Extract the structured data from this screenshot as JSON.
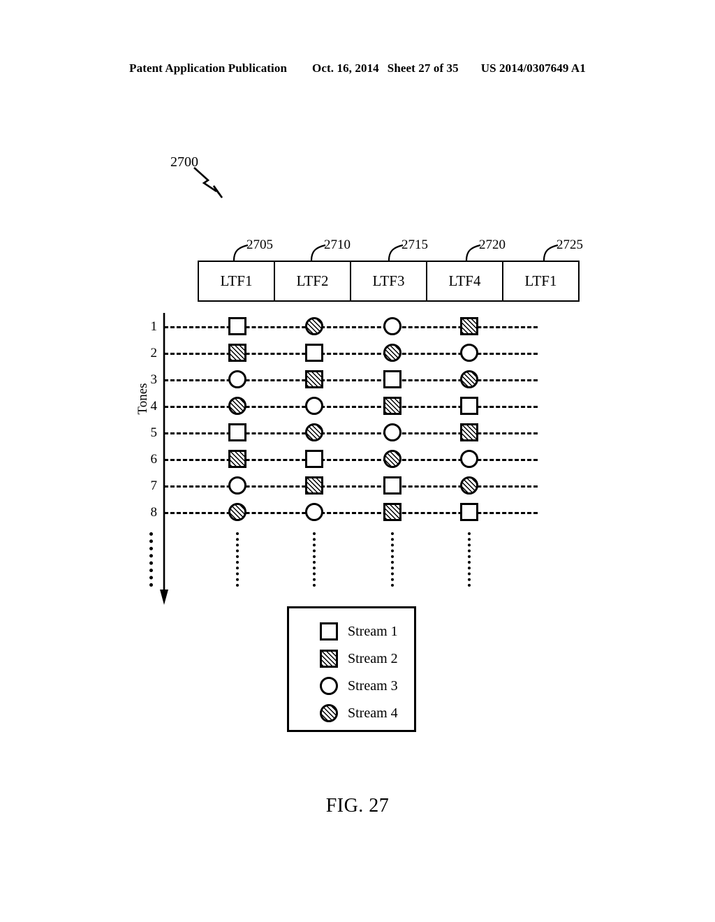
{
  "header": {
    "publication": "Patent Application Publication",
    "date": "Oct. 16, 2014",
    "sheet": "Sheet 27 of 35",
    "patent_number": "US 2014/0307649 A1"
  },
  "figure": {
    "callout": "2700",
    "caption": "FIG. 27",
    "axis_label": "Tones"
  },
  "ltf_boxes": [
    {
      "label": "LTF1",
      "ref": "2705"
    },
    {
      "label": "LTF2",
      "ref": "2710"
    },
    {
      "label": "LTF3",
      "ref": "2715"
    },
    {
      "label": "LTF4",
      "ref": "2720"
    },
    {
      "label": "LTF1",
      "ref": "2725"
    }
  ],
  "tone_rows": [
    {
      "label": "1",
      "symbols": [
        "open-square",
        "hatched-circle",
        "open-circle",
        "hatched-square"
      ]
    },
    {
      "label": "2",
      "symbols": [
        "hatched-square",
        "open-square",
        "hatched-circle",
        "open-circle"
      ]
    },
    {
      "label": "3",
      "symbols": [
        "open-circle",
        "hatched-square",
        "open-square",
        "hatched-circle"
      ]
    },
    {
      "label": "4",
      "symbols": [
        "hatched-circle",
        "open-circle",
        "hatched-square",
        "open-square"
      ]
    },
    {
      "label": "5",
      "symbols": [
        "open-square",
        "hatched-circle",
        "open-circle",
        "hatched-square"
      ]
    },
    {
      "label": "6",
      "symbols": [
        "hatched-square",
        "open-square",
        "hatched-circle",
        "open-circle"
      ]
    },
    {
      "label": "7",
      "symbols": [
        "open-circle",
        "hatched-square",
        "open-square",
        "hatched-circle"
      ]
    },
    {
      "label": "8",
      "symbols": [
        "hatched-circle",
        "open-circle",
        "hatched-square",
        "open-square"
      ]
    }
  ],
  "legend": [
    {
      "symbol": "open-square",
      "label": "Stream 1"
    },
    {
      "symbol": "hatched-square",
      "label": "Stream 2"
    },
    {
      "symbol": "open-circle",
      "label": "Stream 3"
    },
    {
      "symbol": "hatched-circle",
      "label": "Stream 4"
    }
  ],
  "colors": {
    "ink": "#000000",
    "paper": "#ffffff"
  }
}
